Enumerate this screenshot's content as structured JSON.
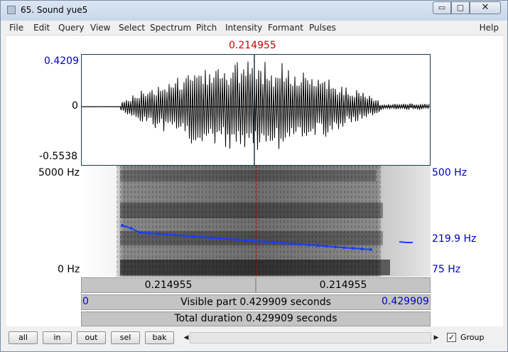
{
  "window": {
    "title": "65. Sound yue5"
  },
  "titlebar": {
    "min_glyph": "▭",
    "max_glyph": "▢",
    "close_glyph": "✕"
  },
  "menu": {
    "items": [
      "File",
      "Edit",
      "Query",
      "View",
      "Select",
      "Spectrum",
      "Pitch",
      "Intensity",
      "Formant",
      "Pulses"
    ],
    "help": "Help"
  },
  "cursor": {
    "time_label": "0.214955"
  },
  "waveform": {
    "top_label": "0.4209",
    "zero_label": "0",
    "bottom_label": "-0.5538"
  },
  "spectrogram": {
    "top_freq_label": "5000 Hz",
    "bottom_freq_label": "0 Hz",
    "pitch_top_label": "500 Hz",
    "pitch_value_label": "219.9 Hz",
    "pitch_bottom_label": "75 Hz"
  },
  "selection_bar": {
    "left_label": "0.214955",
    "right_label": "0.214955"
  },
  "visible_bar": {
    "start": "0",
    "text": "Visible part 0.429909 seconds",
    "end": "0.429909"
  },
  "total_bar": {
    "text": "Total duration 0.429909 seconds"
  },
  "buttons": {
    "all": "all",
    "in": "in",
    "out": "out",
    "sel": "sel",
    "bak": "bak"
  },
  "scroll": {
    "left_arrow": "◀",
    "right_arrow": "▶"
  },
  "group": {
    "label": "Group",
    "checked": "✓"
  },
  "colors": {
    "pitch": "#1a3cff",
    "cursor": "#c80000",
    "axis_blue": "#0000c8"
  }
}
